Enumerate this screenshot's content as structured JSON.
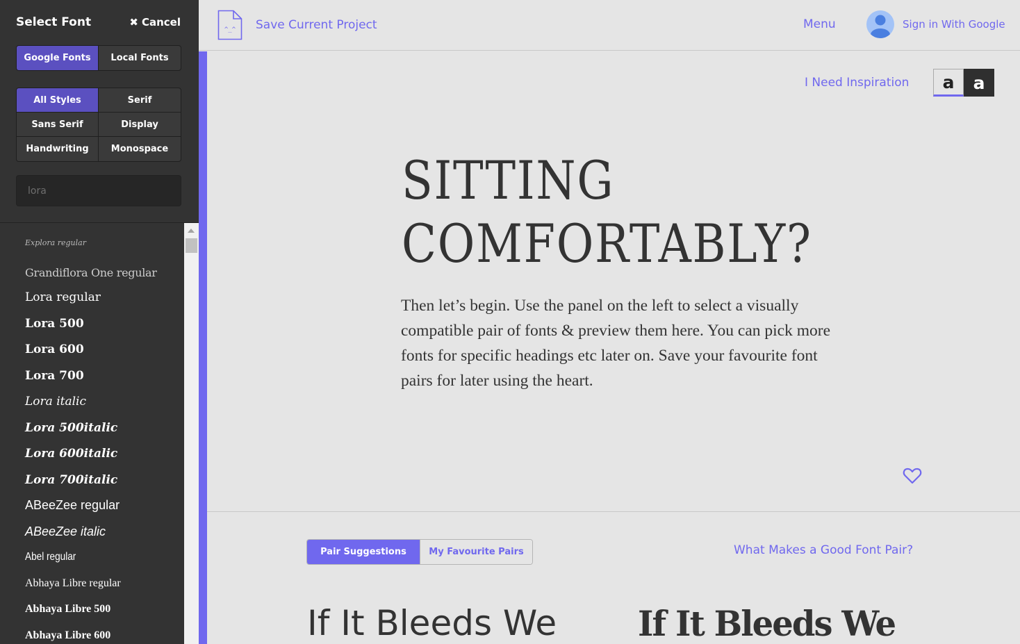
{
  "sidebar": {
    "title": "Select Font",
    "cancel_label": "Cancel",
    "source_tabs": [
      {
        "label": "Google Fonts",
        "active": true
      },
      {
        "label": "Local Fonts",
        "active": false
      }
    ],
    "style_filters": [
      {
        "label": "All Styles",
        "active": true
      },
      {
        "label": "Serif",
        "active": false
      },
      {
        "label": "Sans Serif",
        "active": false
      },
      {
        "label": "Display",
        "active": false
      },
      {
        "label": "Handwriting",
        "active": false
      },
      {
        "label": "Monospace",
        "active": false
      }
    ],
    "search": {
      "value": "",
      "placeholder": "lora"
    },
    "font_items": [
      "Explora regular",
      "Grandiflora One regular",
      "Lora regular",
      "Lora 500",
      "Lora 600",
      "Lora 700",
      "Lora italic",
      "Lora 500italic",
      "Lora 600italic",
      "Lora 700italic",
      "ABeeZee regular",
      "ABeeZee italic",
      "Abel regular",
      "Abhaya Libre regular",
      "Abhaya Libre 500",
      "Abhaya Libre 600"
    ]
  },
  "topbar": {
    "save_label": "Save Current Project",
    "save_icon_glyph": "^_^",
    "menu_label": "Menu",
    "signin_label": "Sign in With Google"
  },
  "hero": {
    "inspiration_label": "I Need Inspiration",
    "theme_options": [
      {
        "label": "a",
        "theme": "light",
        "active": true
      },
      {
        "label": "a",
        "theme": "dark",
        "active": false
      }
    ],
    "title_line1": "SITTING",
    "title_line2": "COMFORTABLY?",
    "body": "Then let’s begin. Use the panel on the left to select a visually compatible pair of fonts & preview them here. You can pick more fonts for specific headings etc later on. Save your favourite font pairs for later using the heart."
  },
  "pairs": {
    "tabs": [
      {
        "label": "Pair Suggestions",
        "active": true
      },
      {
        "label": "My Favourite Pairs",
        "active": false
      }
    ],
    "help_link": "What Makes a Good Font Pair?",
    "sample_left": "If It Bleeds We",
    "sample_right": "If It Bleeds We"
  },
  "colors": {
    "accent": "#7068ee",
    "accent_dark": "#5b50c0",
    "sidebar_bg": "#333333",
    "page_bg": "#e5e5e5",
    "text": "#333333"
  }
}
